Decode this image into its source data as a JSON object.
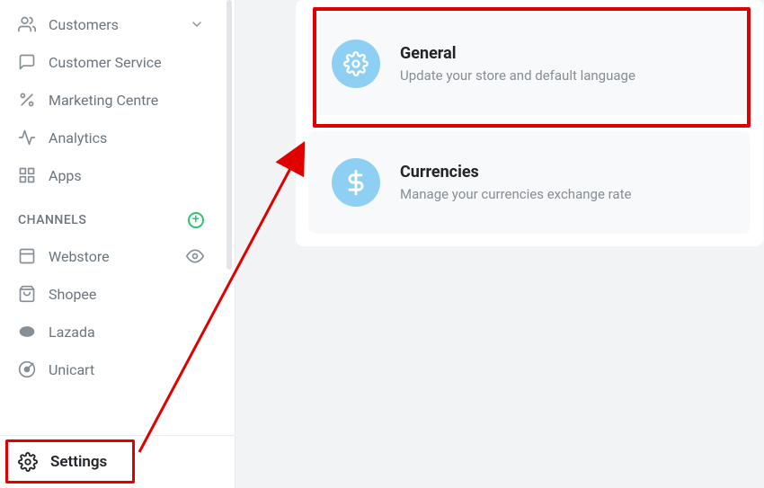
{
  "sidebar": {
    "items": [
      {
        "label": "Customers",
        "icon": "people-icon",
        "chevron": true
      },
      {
        "label": "Customer Service",
        "icon": "chat-icon"
      },
      {
        "label": "Marketing Centre",
        "icon": "percent-icon"
      },
      {
        "label": "Analytics",
        "icon": "activity-icon"
      },
      {
        "label": "Apps",
        "icon": "grid-icon"
      }
    ],
    "channels_header": "CHANNELS",
    "channels": [
      {
        "label": "Webstore",
        "icon": "store-icon",
        "eye": true
      },
      {
        "label": "Shopee",
        "icon": "bag-icon"
      },
      {
        "label": "Lazada",
        "icon": "laz-icon"
      },
      {
        "label": "Unicart",
        "icon": "target-icon"
      }
    ],
    "footer_label": "Settings"
  },
  "cards": [
    {
      "title": "General",
      "desc": "Update your store and default language",
      "icon": "gear"
    },
    {
      "title": "Currencies",
      "desc": "Manage your currencies exchange rate",
      "icon": "dollar"
    }
  ]
}
